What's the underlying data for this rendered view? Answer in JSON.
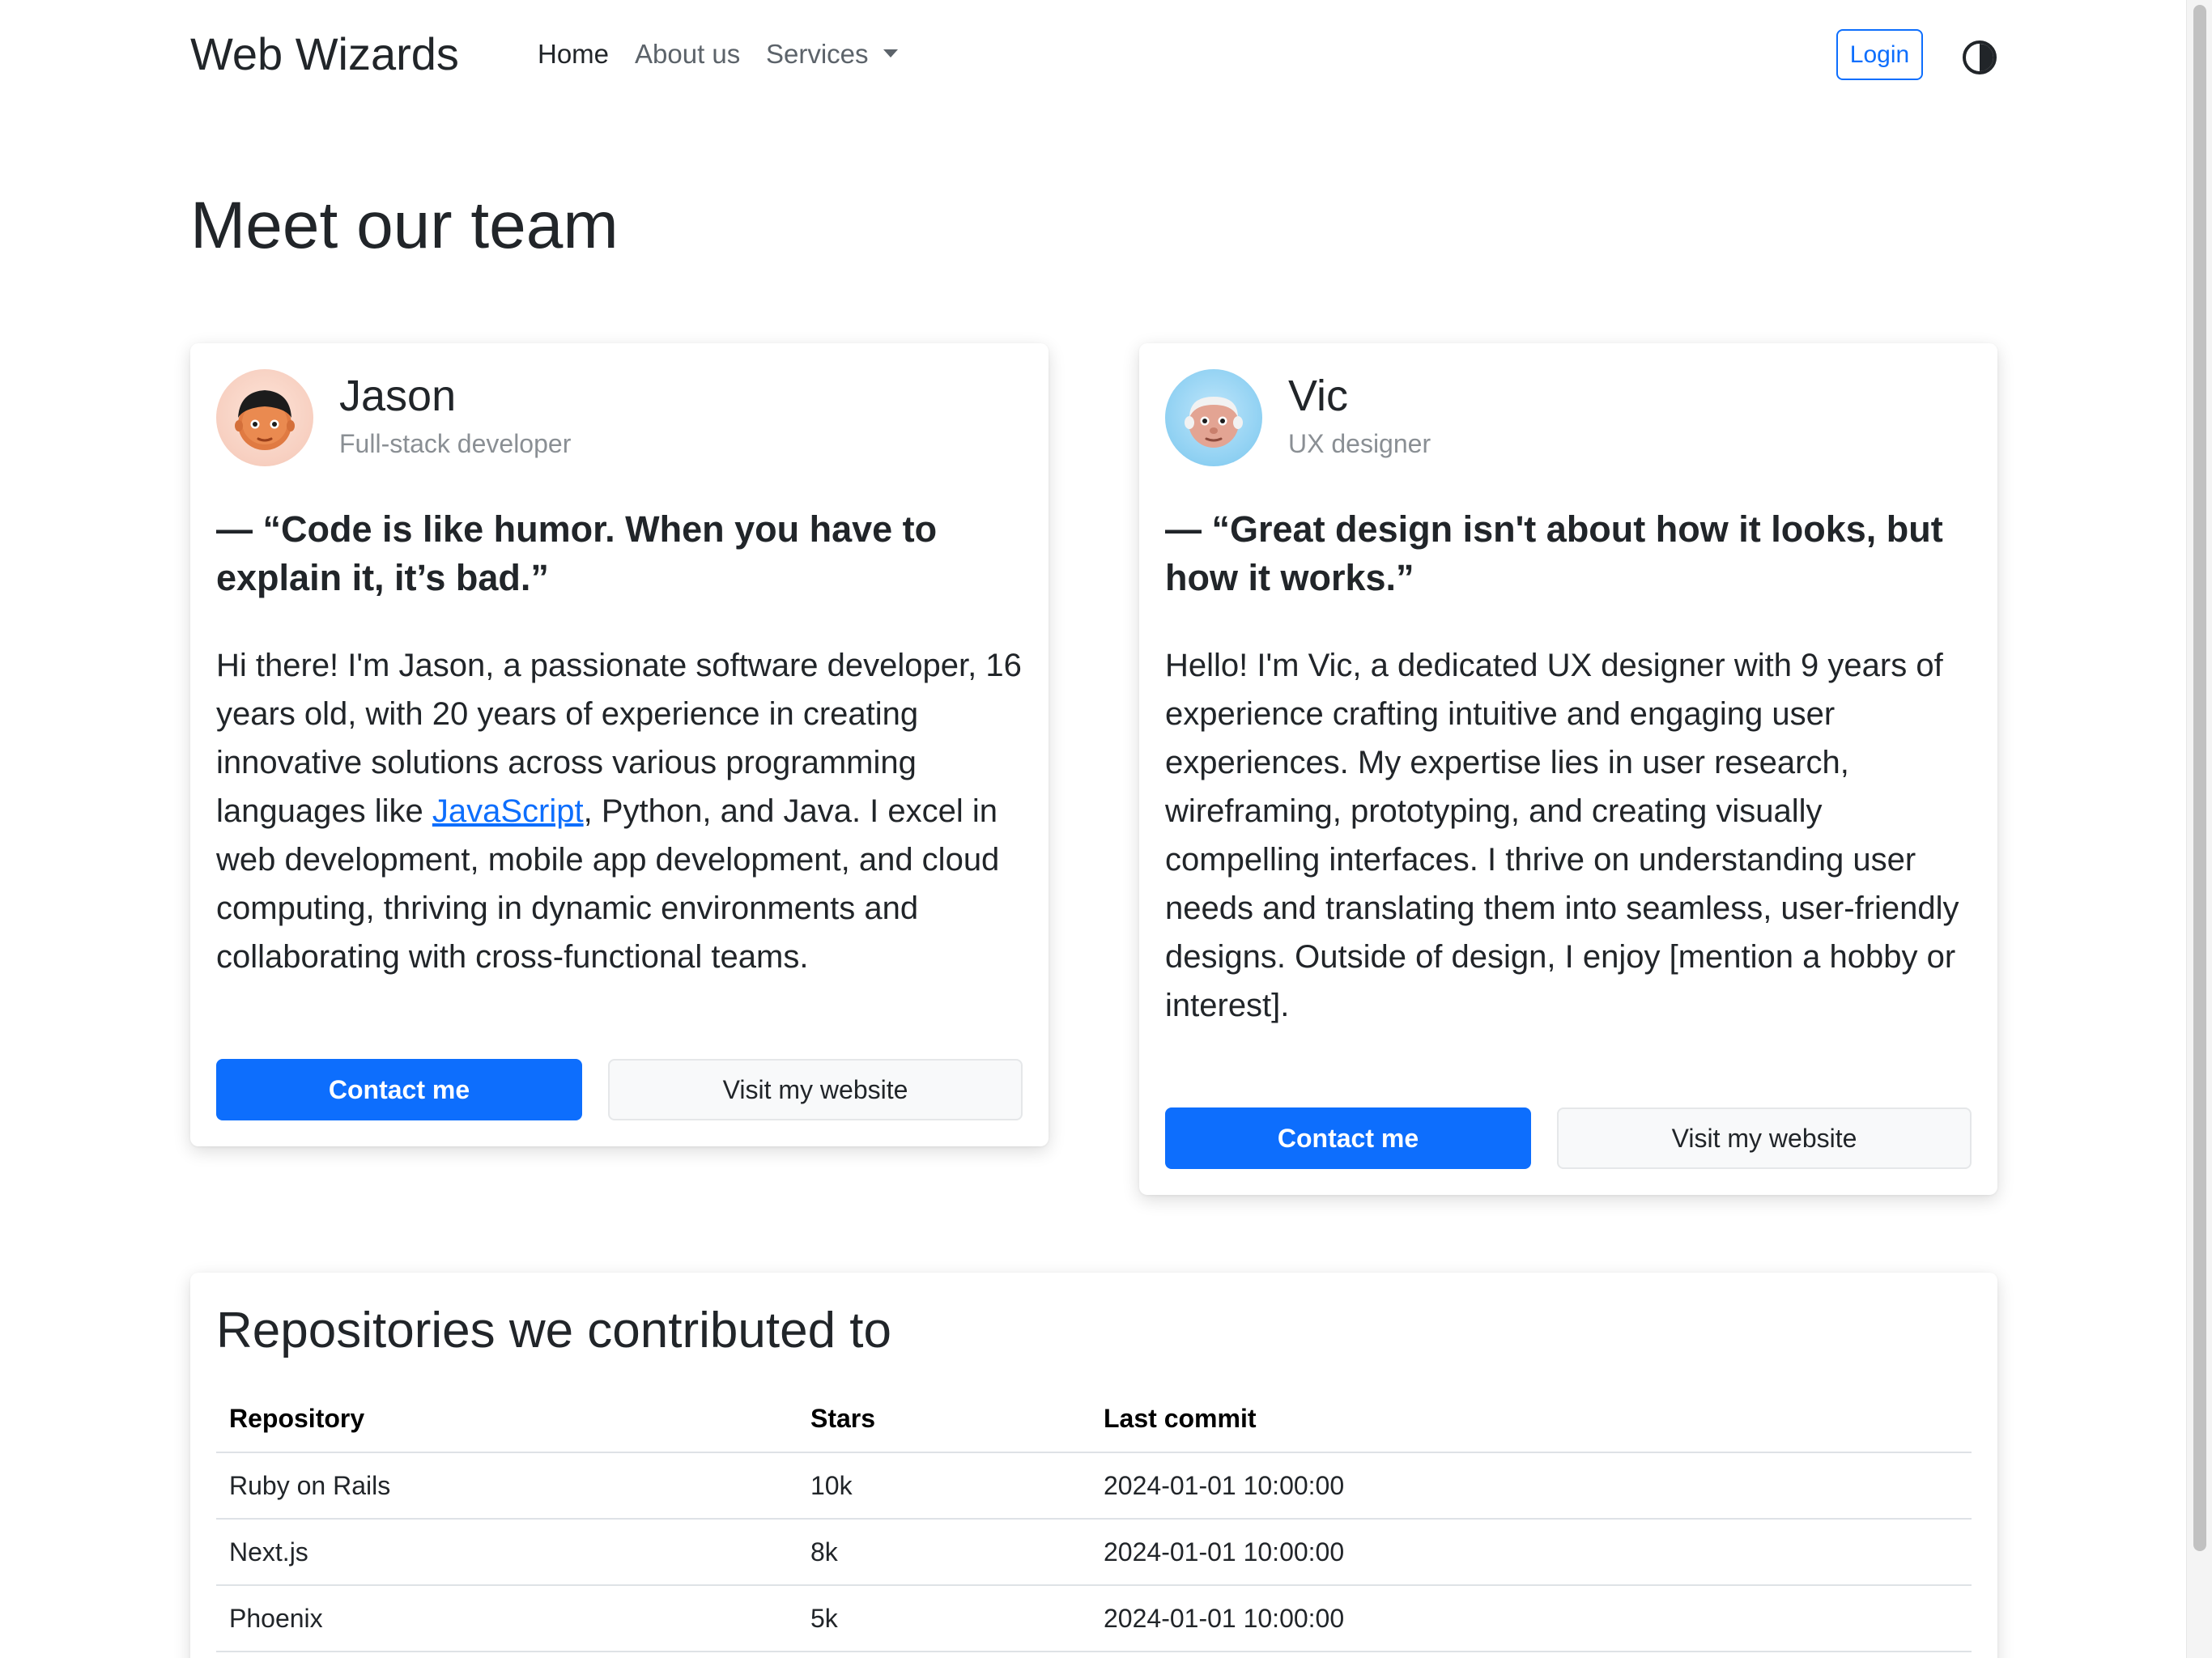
{
  "navbar": {
    "brand": "Web Wizards",
    "links": [
      {
        "label": "Home",
        "active": true
      },
      {
        "label": "About us",
        "active": false
      },
      {
        "label": "Services",
        "active": false,
        "dropdown": true
      }
    ],
    "login_label": "Login",
    "theme_icon": "half-circle-contrast-icon"
  },
  "main": {
    "title": "Meet our team"
  },
  "team": [
    {
      "name": "Jason",
      "role": "Full-stack developer",
      "quote": "— “Code is like humor. When you have to explain it, it’s bad.”",
      "bio_before": "Hi there! I'm Jason, a passionate software developer, 16 years old, with 20 years of experience in creating innovative solutions across various programming languages like ",
      "bio_link": "JavaScript",
      "bio_after": ", Python, and Java. I excel in web development, mobile app development, and cloud computing, thriving in dynamic environments and collaborating with cross-functional teams.",
      "contact_label": "Contact me",
      "website_label": "Visit my website",
      "avatar_icon": "avatar-face-icon"
    },
    {
      "name": "Vic",
      "role": "UX designer",
      "quote": "— “Great design isn't about how it looks, but how it works.”",
      "bio": "Hello! I'm Vic, a dedicated UX designer with 9 years of experience crafting intuitive and engaging user experiences. My expertise lies in user research, wireframing, prototyping, and creating visually compelling interfaces. I thrive on understanding user needs and translating them into seamless, user-friendly designs. Outside of design, I enjoy [mention a hobby or interest].",
      "contact_label": "Contact me",
      "website_label": "Visit my website",
      "avatar_icon": "avatar-face-icon"
    }
  ],
  "repositories": {
    "title": "Repositories we contributed to",
    "columns": [
      "Repository",
      "Stars",
      "Last commit"
    ],
    "rows": [
      [
        "Ruby on Rails",
        "10k",
        "2024-01-01 10:00:00"
      ],
      [
        "Next.js",
        "8k",
        "2024-01-01 10:00:00"
      ],
      [
        "Phoenix",
        "5k",
        "2024-01-01 10:00:00"
      ]
    ]
  },
  "colors": {
    "primary": "#0d6efd",
    "text": "#212529",
    "muted": "#8a8f94"
  }
}
